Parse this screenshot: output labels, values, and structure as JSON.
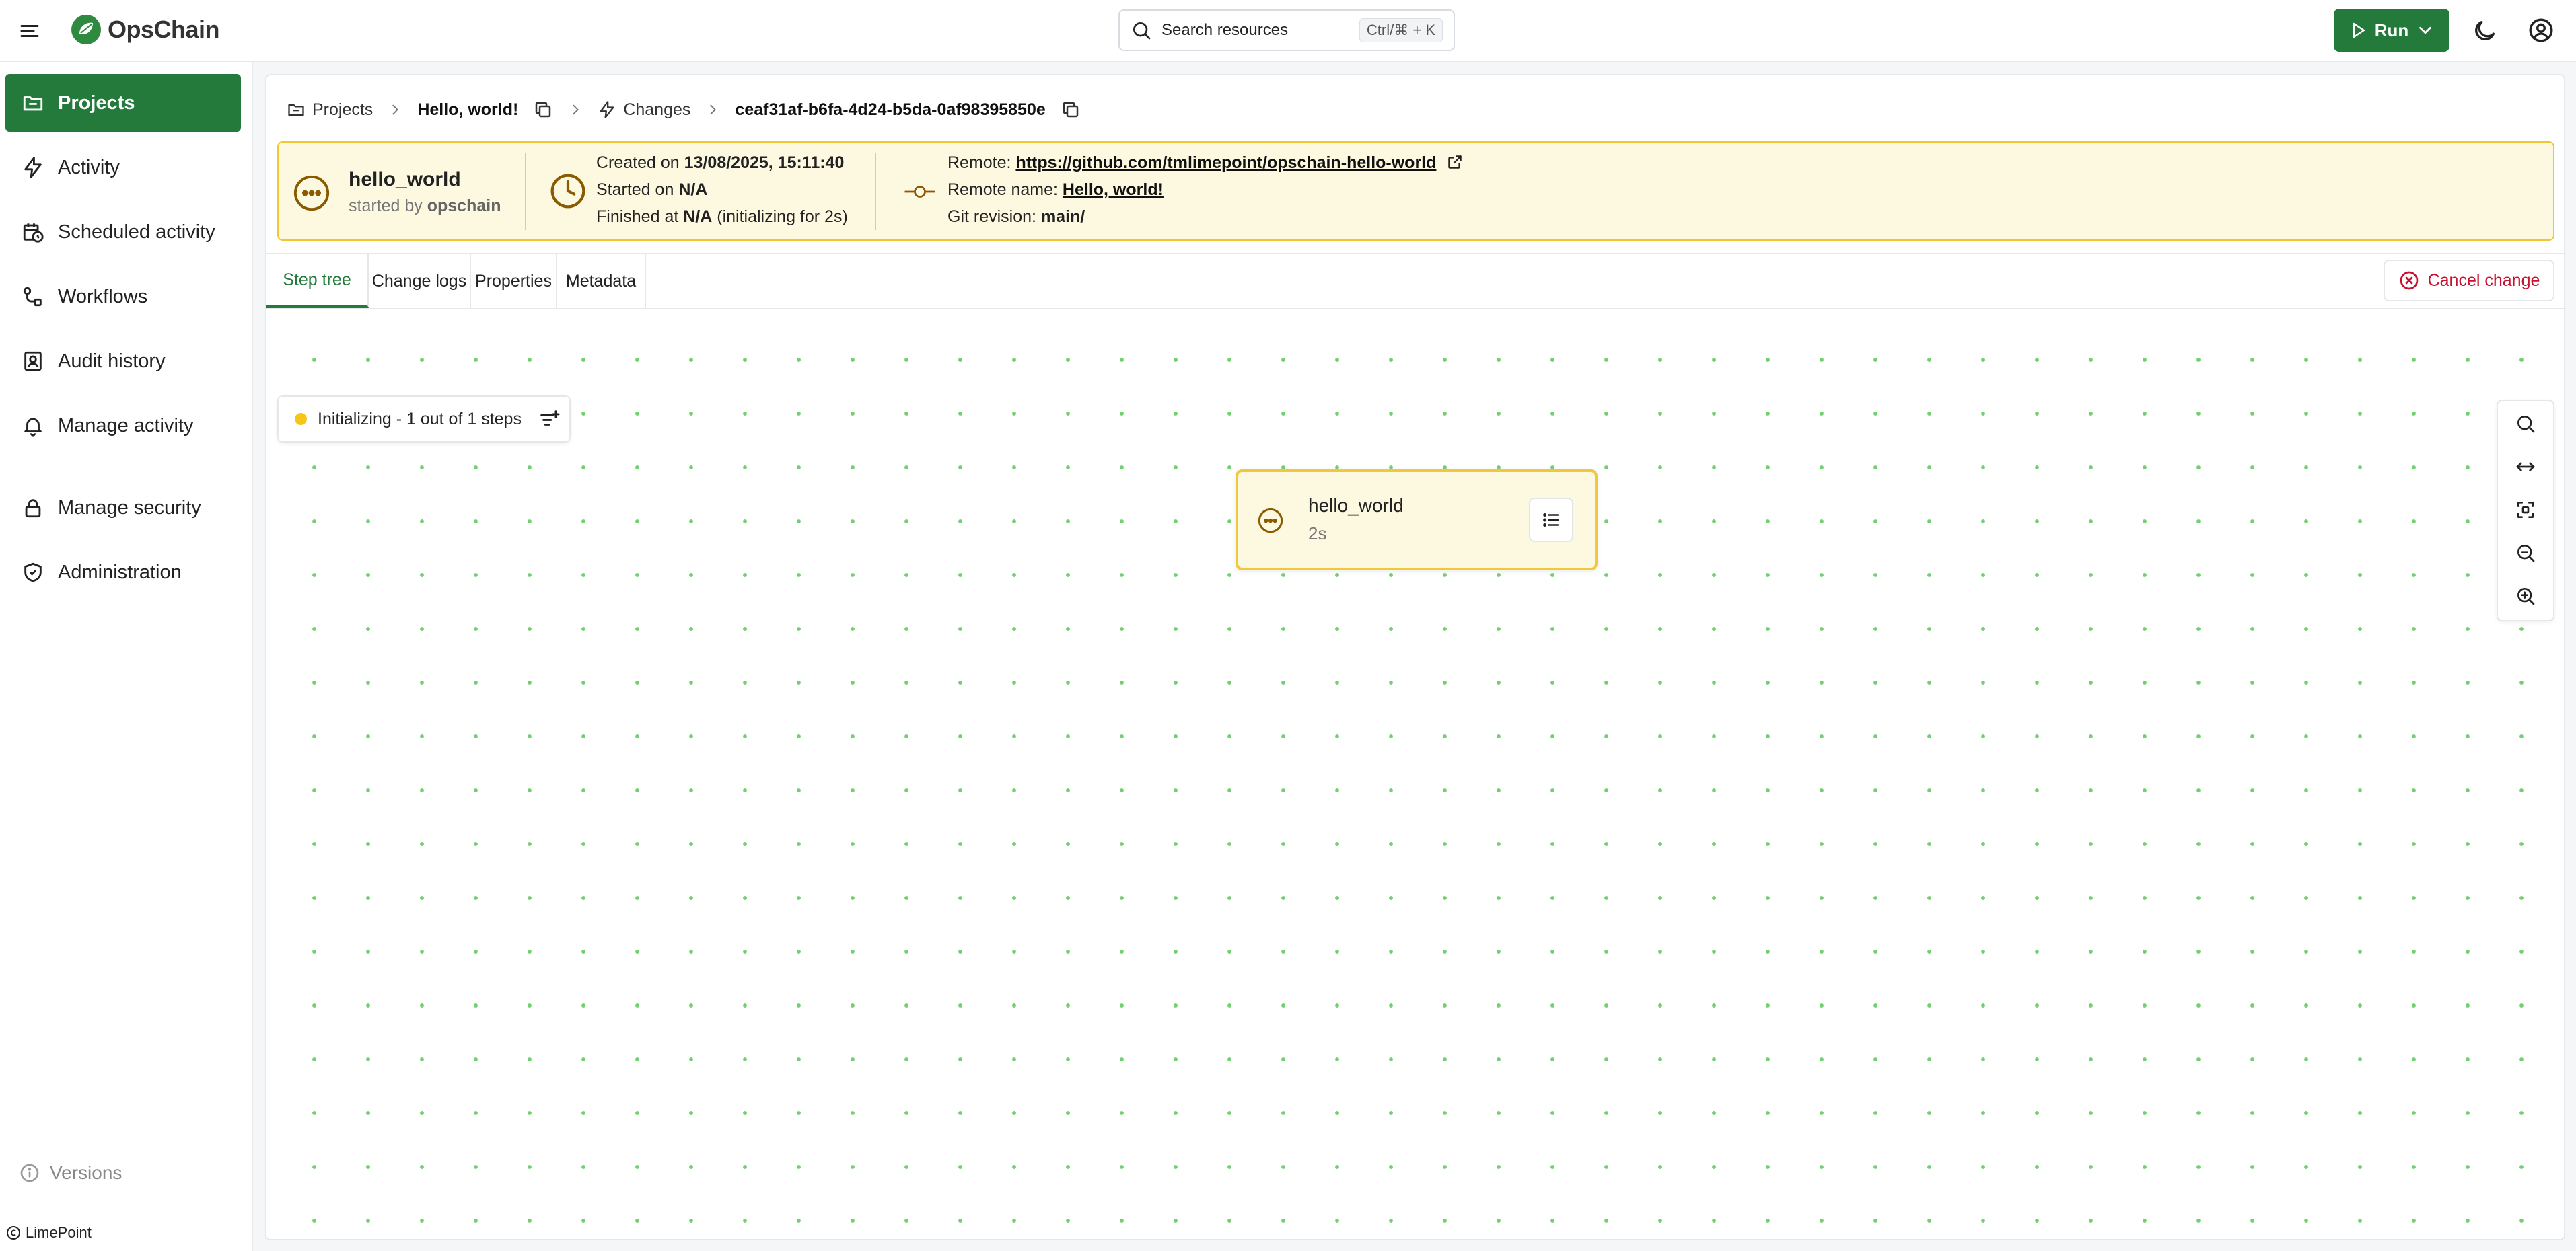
{
  "app": {
    "brand": "OpsChain",
    "colors": {
      "brand": "#237a3b",
      "accent_yellow": "#f0c83a",
      "danger": "#c8102e",
      "grid_dot": "#72d06f"
    }
  },
  "header": {
    "search_placeholder": "Search resources",
    "search_shortcut": "Ctrl/⌘ + K",
    "run_label": "Run",
    "icons": [
      "menu-icon",
      "search-icon",
      "play-icon",
      "chevron-down-icon",
      "moon-icon",
      "user-circle-icon"
    ]
  },
  "sidebar": {
    "items": [
      {
        "label": "Projects",
        "icon": "folder-icon",
        "active": true
      },
      {
        "label": "Activity",
        "icon": "lightning-icon",
        "active": false
      },
      {
        "label": "Scheduled activity",
        "icon": "calendar-clock-icon",
        "active": false
      },
      {
        "label": "Workflows",
        "icon": "workflow-icon",
        "active": false
      },
      {
        "label": "Audit history",
        "icon": "audit-icon",
        "active": false
      },
      {
        "label": "Manage activity",
        "icon": "bell-icon",
        "active": false
      },
      {
        "label": "Manage security",
        "icon": "lock-icon",
        "active": false
      },
      {
        "label": "Administration",
        "icon": "shield-icon",
        "active": false
      }
    ],
    "versions_label": "Versions",
    "copyright": "LimePoint"
  },
  "breadcrumb": {
    "projects": "Projects",
    "project_name": "Hello, world!",
    "changes": "Changes",
    "change_id": "ceaf31af-b6fa-4d24-b5da-0af98395850e"
  },
  "summary": {
    "name": "hello_world",
    "started_by_prefix": "started by",
    "started_by_user": "opschain",
    "created_prefix": "Created on",
    "created_value": "13/08/2025, 15:11:40",
    "started_prefix": "Started on",
    "started_value": "N/A",
    "finished_prefix": "Finished at",
    "finished_value": "N/A",
    "finished_suffix": "(initializing for 2s)",
    "remote_prefix": "Remote:",
    "remote_url": "https://github.com/tmlimepoint/opschain-hello-world",
    "remote_name_prefix": "Remote name:",
    "remote_name": "Hello, world!",
    "git_revision_prefix": "Git revision:",
    "git_revision": "main/"
  },
  "tabs": [
    {
      "label": "Step tree",
      "active": true
    },
    {
      "label": "Change logs",
      "active": false
    },
    {
      "label": "Properties",
      "active": false
    },
    {
      "label": "Metadata",
      "active": false
    }
  ],
  "cancel_label": "Cancel change",
  "canvas": {
    "status_text": "Initializing - 1 out of 1 steps",
    "node": {
      "name": "hello_world",
      "duration": "2s"
    },
    "zoom_controls": [
      "search-icon",
      "fit-width-icon",
      "fit-view-icon",
      "zoom-out-icon",
      "zoom-in-icon"
    ]
  }
}
